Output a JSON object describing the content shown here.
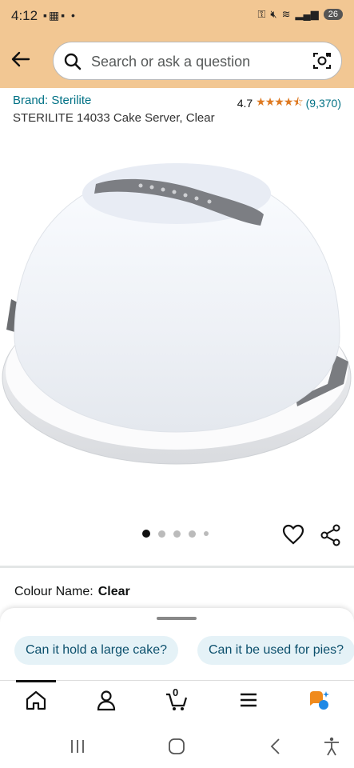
{
  "status_bar": {
    "time": "4:12",
    "battery": "26"
  },
  "search": {
    "placeholder": "Search or ask a question"
  },
  "product": {
    "brand": "Brand: Sterilite",
    "rating": "4.7",
    "stars": "★★★★⯪",
    "review_count": "(9,370)",
    "title": "STERILITE 14033 Cake Server, Clear",
    "image_count": 5,
    "active_image": 1
  },
  "colour": {
    "label": "Colour Name:",
    "value": "Clear"
  },
  "suggestions": [
    {
      "label": "Can it hold a large cake?"
    },
    {
      "label": "Can it be used for pies?"
    }
  ],
  "nav": {
    "cart_count": "0",
    "items": [
      "home-icon",
      "account-icon",
      "cart-icon",
      "menu-icon",
      "rufus-icon"
    ]
  },
  "colors": {
    "header": "#f2c793",
    "link": "#007185",
    "star": "#de7921",
    "chip_bg": "#e5f2f7"
  }
}
